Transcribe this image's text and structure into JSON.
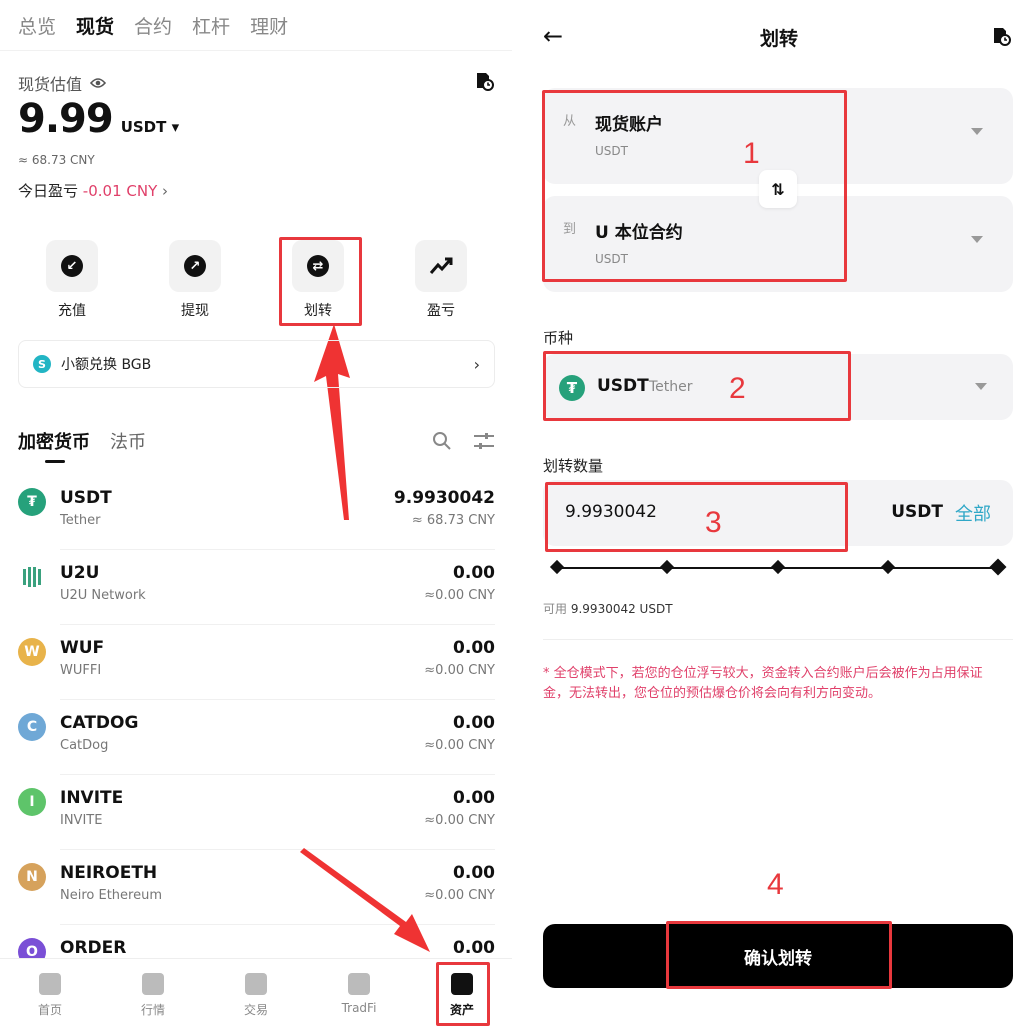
{
  "left": {
    "top_tabs": [
      {
        "label": "总览"
      },
      {
        "label": "现货"
      },
      {
        "label": "合约"
      },
      {
        "label": "杠杆"
      },
      {
        "label": "理财"
      }
    ],
    "estimate_label": "现货估值",
    "balance": "9.99",
    "balance_unit": "USDT",
    "cny_approx": "≈ 68.73 CNY",
    "pnl_label": "今日盈亏",
    "pnl_value": "-0.01 CNY",
    "actions": [
      {
        "label": "充值",
        "icon": "deposit-icon"
      },
      {
        "label": "提现",
        "icon": "withdraw-icon"
      },
      {
        "label": "划转",
        "icon": "transfer-icon"
      },
      {
        "label": "盈亏",
        "icon": "pnl-icon"
      }
    ],
    "bgb_bar": "小额兑换 BGB",
    "asset_tabs": [
      {
        "label": "加密货币"
      },
      {
        "label": "法币"
      }
    ],
    "coins": [
      {
        "symbol": "USDT",
        "name": "Tether",
        "amount": "9.9930042",
        "cny": "≈ 68.73 CNY",
        "color": "#26a17b",
        "glyph": "₮"
      },
      {
        "symbol": "U2U",
        "name": "U2U Network",
        "amount": "0.00",
        "cny": "≈0.00 CNY",
        "color": "#3aa17e",
        "glyph": "U"
      },
      {
        "symbol": "WUF",
        "name": "WUFFI",
        "amount": "0.00",
        "cny": "≈0.00 CNY",
        "color": "#e8b34a",
        "glyph": "W"
      },
      {
        "symbol": "CATDOG",
        "name": "CatDog",
        "amount": "0.00",
        "cny": "≈0.00 CNY",
        "color": "#6fa8d6",
        "glyph": "C"
      },
      {
        "symbol": "INVITE",
        "name": "INVITE",
        "amount": "0.00",
        "cny": "≈0.00 CNY",
        "color": "#5ec46a",
        "glyph": "I"
      },
      {
        "symbol": "NEIROETH",
        "name": "Neiro Ethereum",
        "amount": "0.00",
        "cny": "≈0.00 CNY",
        "color": "#d6a25c",
        "glyph": "N"
      },
      {
        "symbol": "ORDER",
        "name": "",
        "amount": "0.00",
        "cny": "",
        "color": "#7a4fd6",
        "glyph": "O"
      }
    ],
    "nav": [
      {
        "label": "首页"
      },
      {
        "label": "行情"
      },
      {
        "label": "交易"
      },
      {
        "label": "TradFi"
      },
      {
        "label": "资产"
      }
    ]
  },
  "right": {
    "title": "划转",
    "from_key": "从",
    "from_account": "现货账户",
    "from_sub": "USDT",
    "to_key": "到",
    "to_account": "U 本位合约",
    "to_sub": "USDT",
    "coin_label": "币种",
    "coin_symbol": "USDT",
    "coin_name": "Tether",
    "amount_label": "划转数量",
    "amount_value": "9.9930042",
    "amount_unit": "USDT",
    "all_label": "全部",
    "available_key": "可用",
    "available_value": "9.9930042 USDT",
    "warning": "* 全仓模式下，若您的仓位浮亏较大，资金转入合约账户后会被作为占用保证金，无法转出，您仓位的预估爆仓价将会向有利方向变动。",
    "confirm_label": "确认划转"
  },
  "annotations": [
    "1",
    "2",
    "3",
    "4"
  ],
  "colors": {
    "highlight": "#e8383d",
    "negative": "#e0406a",
    "link": "#2fa7c7",
    "tether": "#26a17b"
  }
}
